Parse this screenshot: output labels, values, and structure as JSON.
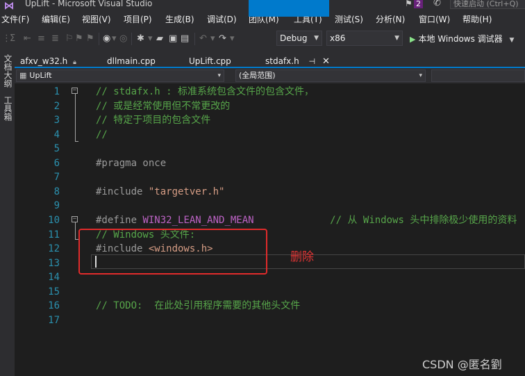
{
  "window": {
    "title": "UpLift - Microsoft Visual Studio",
    "notification_count": "2",
    "quick_launch_placeholder": "快速启动 (Ctrl+Q)"
  },
  "menu": [
    "文件(F)",
    "编辑(E)",
    "视图(V)",
    "项目(P)",
    "生成(B)",
    "调试(D)",
    "团队(M)",
    "工具(T)",
    "测试(S)",
    "分析(N)",
    "窗口(W)",
    "帮助(H)"
  ],
  "toolbar": {
    "configuration": "Debug",
    "platform": "x86",
    "run_label": "本地 Windows 调试器"
  },
  "side_tabs": [
    "文档大纲",
    "工具箱"
  ],
  "tabs": [
    {
      "label": "afxv_w32.h",
      "pinned": true,
      "active": false
    },
    {
      "label": "dllmain.cpp",
      "pinned": false,
      "active": false
    },
    {
      "label": "UpLift.cpp",
      "pinned": false,
      "active": false
    },
    {
      "label": "stdafx.h",
      "pinned": true,
      "active": true
    }
  ],
  "nav": {
    "project": "UpLift",
    "scope": "(全局范围)"
  },
  "editor": {
    "lines": [
      {
        "n": "1",
        "parts": [
          {
            "c": "cm",
            "t": "// stdafx.h : 标准系统包含文件的包含文件，"
          }
        ]
      },
      {
        "n": "2",
        "parts": [
          {
            "c": "cm",
            "t": "// 或是经常使用但不常更改的"
          }
        ]
      },
      {
        "n": "3",
        "parts": [
          {
            "c": "cm",
            "t": "// 特定于项目的包含文件"
          }
        ]
      },
      {
        "n": "4",
        "parts": [
          {
            "c": "cm",
            "t": "//"
          }
        ]
      },
      {
        "n": "5",
        "parts": []
      },
      {
        "n": "6",
        "parts": [
          {
            "c": "pp",
            "t": "#pragma once"
          }
        ]
      },
      {
        "n": "7",
        "parts": []
      },
      {
        "n": "8",
        "parts": [
          {
            "c": "pp",
            "t": "#include "
          },
          {
            "c": "str",
            "t": "\"targetver.h\""
          }
        ]
      },
      {
        "n": "9",
        "parts": []
      },
      {
        "n": "10",
        "parts": [
          {
            "c": "pp",
            "t": "#define "
          },
          {
            "c": "mac",
            "t": "WIN32_LEAN_AND_MEAN"
          },
          {
            "c": "pp",
            "t": "             "
          },
          {
            "c": "cm",
            "t": "// 从 Windows 头中排除极少使用的资料"
          }
        ]
      },
      {
        "n": "11",
        "parts": [
          {
            "c": "cm",
            "t": "// Windows 头文件:"
          }
        ]
      },
      {
        "n": "12",
        "parts": [
          {
            "c": "pp",
            "t": "#include "
          },
          {
            "c": "str",
            "t": "<windows.h>"
          }
        ]
      },
      {
        "n": "13",
        "parts": []
      },
      {
        "n": "14",
        "parts": []
      },
      {
        "n": "15",
        "parts": []
      },
      {
        "n": "16",
        "parts": [
          {
            "c": "cm",
            "t": "// TODO:  在此处引用程序需要的其他头文件"
          }
        ]
      },
      {
        "n": "17",
        "parts": []
      }
    ]
  },
  "annotation": {
    "label": "删除"
  },
  "watermark": "CSDN @匿名劉",
  "colors": {
    "accent": "#007acc",
    "annotation": "#e22b2b",
    "comment": "#57a64a",
    "line_number": "#2b91af",
    "macro": "#bd63c5",
    "string": "#d69d85"
  }
}
